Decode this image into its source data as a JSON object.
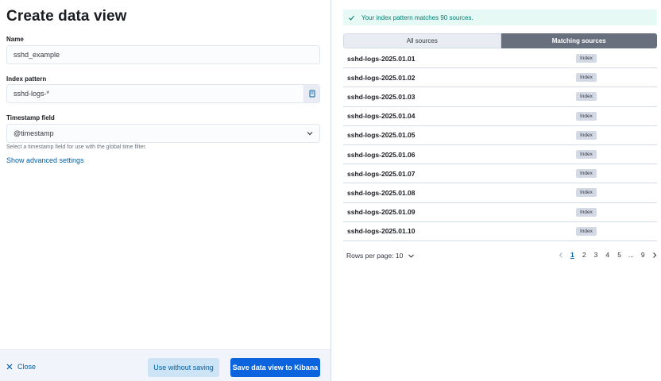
{
  "left": {
    "title": "Create data view",
    "name_field": {
      "label": "Name",
      "value": "sshd_example"
    },
    "index_pattern": {
      "label": "Index pattern",
      "value": "sshd-logs-*"
    },
    "timestamp": {
      "label": "Timestamp field",
      "value": "@timestamp",
      "help": "Select a timestamp field for use with the global time filter."
    },
    "advanced_link": "Show advanced settings"
  },
  "footer": {
    "close_label": "Close",
    "use_without_saving": "Use without saving",
    "save_label": "Save data view to Kibana"
  },
  "right": {
    "callout": "Your index pattern matches 90 sources.",
    "tabs": [
      "All sources",
      "Matching sources"
    ],
    "active_tab": "Matching sources",
    "rows": [
      {
        "name": "sshd-logs-2025.01.01",
        "badge": "Index"
      },
      {
        "name": "sshd-logs-2025.01.02",
        "badge": "Index"
      },
      {
        "name": "sshd-logs-2025.01.03",
        "badge": "Index"
      },
      {
        "name": "sshd-logs-2025.01.04",
        "badge": "Index"
      },
      {
        "name": "sshd-logs-2025.01.05",
        "badge": "Index"
      },
      {
        "name": "sshd-logs-2025.01.06",
        "badge": "Index"
      },
      {
        "name": "sshd-logs-2025.01.07",
        "badge": "Index"
      },
      {
        "name": "sshd-logs-2025.01.08",
        "badge": "Index"
      },
      {
        "name": "sshd-logs-2025.01.09",
        "badge": "Index"
      },
      {
        "name": "sshd-logs-2025.01.10",
        "badge": "Index"
      }
    ],
    "rows_per_page": "Rows per page: 10",
    "pagination": {
      "pages": [
        "1",
        "2",
        "3",
        "4",
        "5",
        "...",
        "9"
      ],
      "current": "1"
    }
  },
  "colors": {
    "primary": "#0b64dd",
    "link": "#0061a6",
    "success_bg": "#e6f9f5",
    "success_text": "#017d73",
    "active_tab": "#69707d"
  }
}
